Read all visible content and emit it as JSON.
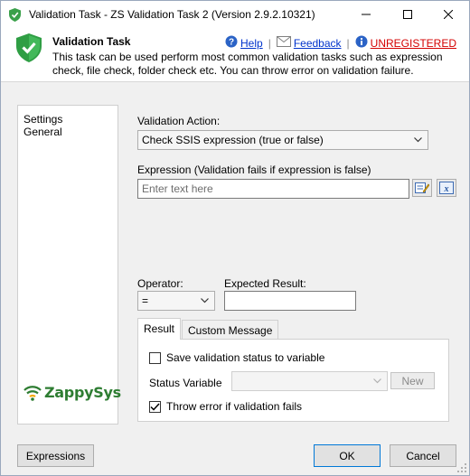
{
  "window": {
    "title": "Validation Task - ZS Validation Task 2 (Version 2.9.2.10321)"
  },
  "header": {
    "title": "Validation Task",
    "description": "This task can be used perform most common validation tasks such as expression check, file check, folder check etc. You can throw error on validation failure.",
    "help_label": "Help",
    "feedback_label": "Feedback",
    "unregistered_label": "UNREGISTERED"
  },
  "sidebar": {
    "items": [
      {
        "label": "Settings"
      },
      {
        "label": "General"
      }
    ],
    "logo_text": "ZappySys"
  },
  "form": {
    "validation_action_label": "Validation Action:",
    "validation_action_value": "Check SSIS expression (true or false)",
    "expression_label": "Expression (Validation fails if expression is false)",
    "expression_placeholder": "Enter text here",
    "operator_label": "Operator:",
    "operator_value": "=",
    "expected_result_label": "Expected Result:",
    "expected_result_value": ""
  },
  "tabs": [
    {
      "label": "Result",
      "active": true
    },
    {
      "label": "Custom Message",
      "active": false
    }
  ],
  "result_tab": {
    "save_status_label": "Save validation status to variable",
    "save_status_checked": false,
    "status_variable_label": "Status Variable",
    "status_variable_value": "",
    "new_button_label": "New",
    "throw_error_label": "Throw error if validation fails",
    "throw_error_checked": true
  },
  "footer": {
    "expressions_label": "Expressions",
    "ok_label": "OK",
    "cancel_label": "Cancel"
  },
  "colors": {
    "link": "#0033cc",
    "unregistered": "#d40000",
    "brand_green": "#2e7d32",
    "default_button_border": "#0078d7"
  }
}
